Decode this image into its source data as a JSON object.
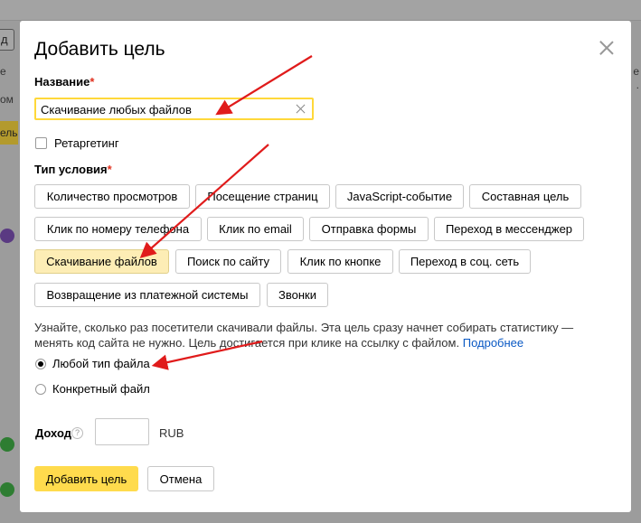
{
  "background": {
    "edge_button_glyph": "д",
    "edge_text_1": "е",
    "edge_text_2": "ом",
    "edge_yellow_text": "ель",
    "right_text_1": "е",
    "right_text_2": "."
  },
  "modal": {
    "title": "Добавить цель",
    "name_label": "Название",
    "required_mark": "*",
    "name_value": "Скачивание любых файлов",
    "retargeting_label": "Ретаргетинг",
    "condition_label": "Тип условия",
    "condition_types": [
      "Количество просмотров",
      "Посещение страниц",
      "JavaScript-событие",
      "Составная цель",
      "Клик по номеру телефона",
      "Клик по email",
      "Отправка формы",
      "Переход в мессенджер",
      "Скачивание файлов",
      "Поиск по сайту",
      "Клик по кнопке",
      "Переход в соц. сеть",
      "Возвращение из платежной системы",
      "Звонки"
    ],
    "selected_condition": "Скачивание файлов",
    "description": "Узнайте, сколько раз посетители скачивали файлы. Эта цель сразу начнет собирать статистику — менять код сайта не нужно. Цель достигается при клике на ссылку с файлом.",
    "more_link": "Подробнее",
    "radio_any": "Любой тип файла",
    "radio_specific": "Конкретный файл",
    "income_label": "Доход",
    "income_help": "?",
    "income_value": "",
    "currency": "RUB",
    "submit_label": "Добавить цель",
    "cancel_label": "Отмена"
  },
  "colors": {
    "accent_yellow": "#ffdb4d",
    "selected_bg": "#fdedb5",
    "required": "#e0301e",
    "link": "#0a59c4",
    "annotation_arrow": "#e01b1b"
  }
}
